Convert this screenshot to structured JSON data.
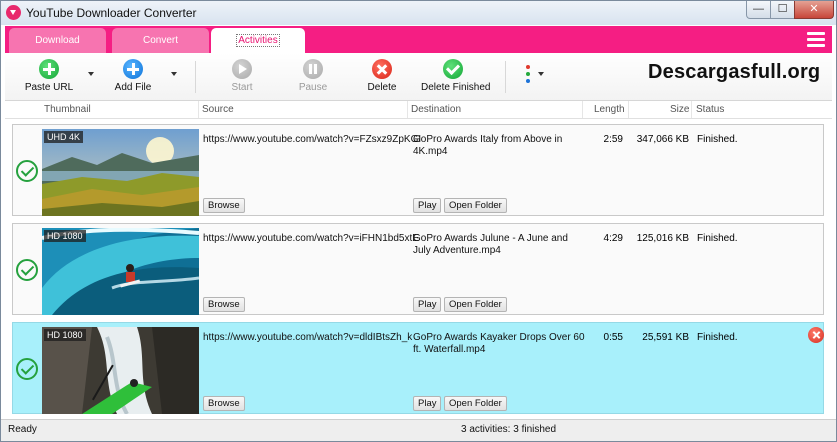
{
  "window": {
    "title": "YouTube Downloader Converter",
    "controls": {
      "minimize": "—",
      "maximize": "☐",
      "close": "✕"
    }
  },
  "colors": {
    "accent": "#f51e83",
    "tab_inactive": "#f774b0",
    "selected_row": "#a8f0fb",
    "success": "#25a13e"
  },
  "tabs": [
    {
      "label": "Download",
      "active": false
    },
    {
      "label": "Convert",
      "active": false
    },
    {
      "label": "Activities",
      "active": true
    }
  ],
  "toolbar": {
    "paste_url": "Paste URL",
    "add_file": "Add File",
    "start": "Start",
    "pause": "Pause",
    "delete": "Delete",
    "delete_finished": "Delete Finished"
  },
  "brand": "Descargasfull.org",
  "columns": {
    "thumbnail": "Thumbnail",
    "source": "Source",
    "destination": "Destination",
    "length": "Length",
    "size": "Size",
    "status": "Status"
  },
  "rows": [
    {
      "badge": "UHD 4K",
      "source": "https://www.youtube.com/watch?v=FZsxz9ZpKGI",
      "destination": "GoPro Awards  Italy from Above in 4K.mp4",
      "length": "2:59",
      "size": "347,066 KB",
      "status": "Finished.",
      "browse": "Browse",
      "play": "Play",
      "open_folder": "Open Folder",
      "selected": false
    },
    {
      "badge": "HD 1080",
      "source": "https://www.youtube.com/watch?v=iFHN1bd5xtE",
      "destination": "GoPro Awards  Julune - A June and July Adventure.mp4",
      "length": "4:29",
      "size": "125,016 KB",
      "status": "Finished.",
      "browse": "Browse",
      "play": "Play",
      "open_folder": "Open Folder",
      "selected": false
    },
    {
      "badge": "HD 1080",
      "source": "https://www.youtube.com/watch?v=dldIBtsZh_k",
      "destination": "GoPro Awards  Kayaker Drops Over 60 ft. Waterfall.mp4",
      "length": "0:55",
      "size": "25,591 KB",
      "status": "Finished.",
      "browse": "Browse",
      "play": "Play",
      "open_folder": "Open Folder",
      "selected": true
    }
  ],
  "statusbar": {
    "left": "Ready",
    "summary": "3 activities: 3 finished"
  }
}
